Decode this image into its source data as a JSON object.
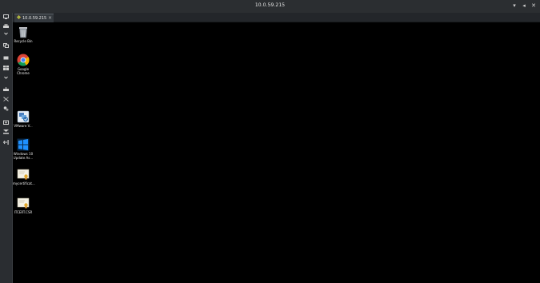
{
  "window": {
    "title": "10.0.59.215"
  },
  "tabs": [
    {
      "label": "10.0.59.215",
      "close_glyph": "×",
      "active": true
    }
  ],
  "window_controls": {
    "minimize_glyph": "▾",
    "restore_glyph": "◂",
    "close_glyph": "✕"
  },
  "toolbar": {
    "icons": [
      "display-icon",
      "printer-icon",
      "chevron-down-icon",
      "copy-icon",
      "monitor-icon",
      "windows-icon",
      "chevron-down-icon",
      "keyboard-icon",
      "tools-icon",
      "settings-icon",
      "camera-icon",
      "fullscreen-icon",
      "scale-icon",
      "disconnect-icon"
    ]
  },
  "desktop": {
    "icons": [
      {
        "name": "recycle-bin-icon",
        "label": "Recycle Bin"
      },
      {
        "name": "chrome-icon",
        "label": "Google\nChrome"
      },
      {
        "name": "vmware-icon",
        "label": "VMware V..."
      },
      {
        "name": "windows-update-icon",
        "label": "Windows 10\nUpdate As..."
      },
      {
        "name": "certificate-file-icon",
        "label": "mycertificat..."
      },
      {
        "name": "certificate-file-icon",
        "label": "ITCERT.CSR"
      }
    ]
  },
  "colors": {
    "titlebar_bg": "#2b2e31",
    "toolbar_bg": "#2a2d31",
    "desktop_bg": "#000000",
    "text": "#e6e6e6"
  }
}
